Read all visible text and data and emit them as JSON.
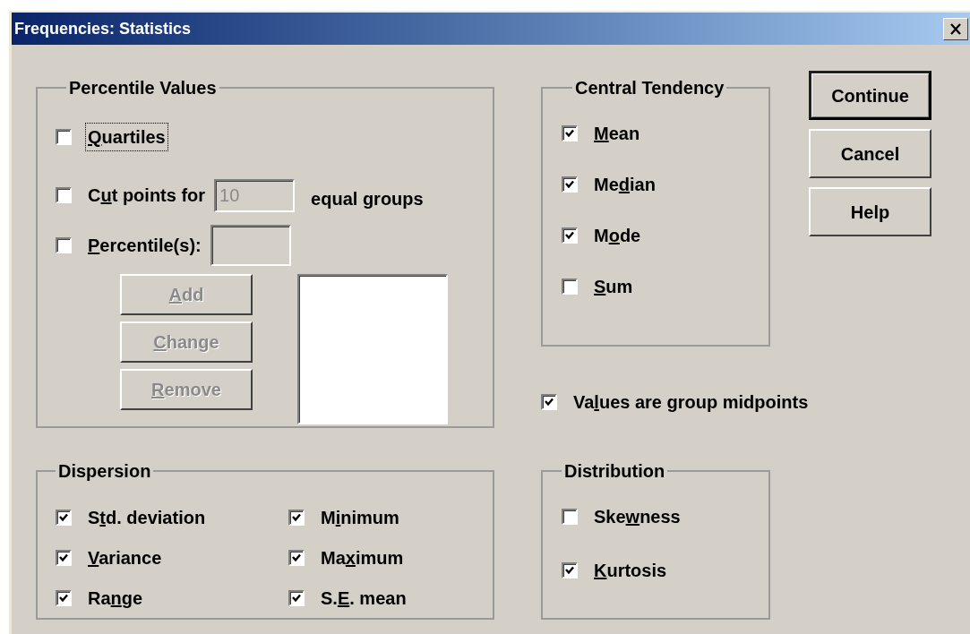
{
  "window": {
    "title": "Frequencies: Statistics"
  },
  "percentile_values": {
    "title": "Percentile Values",
    "quartiles": {
      "label": [
        {
          "text": "Q",
          "underlined": true
        },
        {
          "text": "uartiles",
          "underlined": false
        }
      ],
      "checked": false,
      "focused": true
    },
    "cut_points": {
      "label": [
        {
          "text": "C",
          "underlined": false
        },
        {
          "text": "u",
          "underlined": true
        },
        {
          "text": "t points for",
          "underlined": false
        }
      ],
      "checked": false,
      "field": {
        "value": "10",
        "disabled": true
      },
      "suffix": "equal groups"
    },
    "percentiles": {
      "label": [
        {
          "text": "P",
          "underlined": true
        },
        {
          "text": "ercentile(s):",
          "underlined": false
        }
      ],
      "checked": false,
      "field": {
        "disabled": true
      }
    },
    "buttons": [
      {
        "label": [
          {
            "text": "A",
            "underlined": true
          },
          {
            "text": "dd",
            "underlined": false
          }
        ],
        "disabled": true
      },
      {
        "label": [
          {
            "text": "C",
            "underlined": true
          },
          {
            "text": "hange",
            "underlined": false
          }
        ],
        "disabled": true
      },
      {
        "label": [
          {
            "text": "R",
            "underlined": true
          },
          {
            "text": "emove",
            "underlined": false
          }
        ],
        "disabled": true
      }
    ]
  },
  "central_tendency": {
    "title": "Central Tendency",
    "items": [
      {
        "label": [
          {
            "text": "M",
            "underlined": true
          },
          {
            "text": "ean",
            "underlined": false
          }
        ],
        "checked": true
      },
      {
        "label": [
          {
            "text": "Me",
            "underlined": false
          },
          {
            "text": "d",
            "underlined": true
          },
          {
            "text": "ian",
            "underlined": false
          }
        ],
        "checked": true
      },
      {
        "label": [
          {
            "text": "M",
            "underlined": false
          },
          {
            "text": "o",
            "underlined": true
          },
          {
            "text": "de",
            "underlined": false
          }
        ],
        "checked": true
      },
      {
        "label": [
          {
            "text": "S",
            "underlined": true
          },
          {
            "text": "um",
            "underlined": false
          }
        ],
        "checked": false
      }
    ]
  },
  "buttons": [
    {
      "label": "Continue",
      "default": true
    },
    {
      "label": "Cancel",
      "default": false
    },
    {
      "label": "Help",
      "default": false
    }
  ],
  "group_midpoints": {
    "label": [
      {
        "text": "Va",
        "underlined": false
      },
      {
        "text": "l",
        "underlined": true
      },
      {
        "text": "ues are group midpoints",
        "underlined": false
      }
    ],
    "checked": true
  },
  "dispersion": {
    "title": "Dispersion",
    "items": [
      {
        "label": [
          {
            "text": "S",
            "underlined": false
          },
          {
            "text": "t",
            "underlined": true
          },
          {
            "text": "d. deviation",
            "underlined": false
          }
        ],
        "checked": true
      },
      {
        "label": [
          {
            "text": "M",
            "underlined": false
          },
          {
            "text": "i",
            "underlined": true
          },
          {
            "text": "nimum",
            "underlined": false
          }
        ],
        "checked": true
      },
      {
        "label": [
          {
            "text": "V",
            "underlined": true
          },
          {
            "text": "ariance",
            "underlined": false
          }
        ],
        "checked": true
      },
      {
        "label": [
          {
            "text": "Ma",
            "underlined": false
          },
          {
            "text": "x",
            "underlined": true
          },
          {
            "text": "imum",
            "underlined": false
          }
        ],
        "checked": true
      },
      {
        "label": [
          {
            "text": "Ra",
            "underlined": false
          },
          {
            "text": "n",
            "underlined": true
          },
          {
            "text": "ge",
            "underlined": false
          }
        ],
        "checked": true
      },
      {
        "label": [
          {
            "text": "S.",
            "underlined": false
          },
          {
            "text": "E",
            "underlined": true
          },
          {
            "text": ". mean",
            "underlined": false
          }
        ],
        "checked": true
      }
    ]
  },
  "distribution": {
    "title": "Distribution",
    "items": [
      {
        "label": [
          {
            "text": "Ske",
            "underlined": false
          },
          {
            "text": "w",
            "underlined": true
          },
          {
            "text": "ness",
            "underlined": false
          }
        ],
        "checked": false
      },
      {
        "label": [
          {
            "text": "K",
            "underlined": true
          },
          {
            "text": "urtosis",
            "underlined": false
          }
        ],
        "checked": true
      }
    ]
  }
}
